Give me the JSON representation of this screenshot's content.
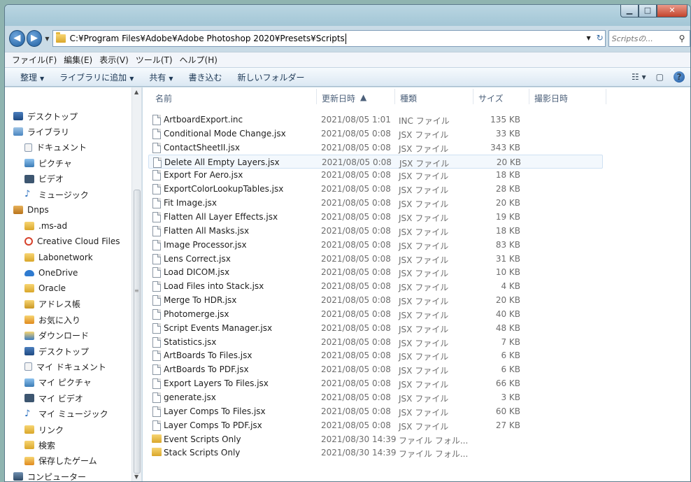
{
  "window": {
    "address_path": "C:¥Program Files¥Adobe¥Adobe Photoshop 2020¥Presets¥Scripts",
    "search_placeholder": "Scriptsの...",
    "caption_min": "▁",
    "caption_max": "□",
    "caption_close": "✕"
  },
  "menu": [
    "ファイル(F)",
    "編集(E)",
    "表示(V)",
    "ツール(T)",
    "ヘルプ(H)"
  ],
  "toolbar": {
    "organize": "整理",
    "add_library": "ライブラリに追加",
    "share": "共有",
    "burn": "書き込む",
    "new_folder": "新しいフォルダー"
  },
  "nav_pane": [
    {
      "label": "デスクトップ",
      "icon": "desktop-icon"
    },
    {
      "label": "ライブラリ",
      "icon": "library-icon"
    },
    {
      "label": "ドキュメント",
      "icon": "documents-icon"
    },
    {
      "label": "ピクチャ",
      "icon": "pictures-icon"
    },
    {
      "label": "ビデオ",
      "icon": "videos-icon"
    },
    {
      "label": "ミュージック",
      "icon": "music-icon"
    },
    {
      "label": "Dnps",
      "icon": "user-folder-icon"
    },
    {
      "label": ".ms-ad",
      "icon": "folder-icon"
    },
    {
      "label": "Creative Cloud Files",
      "icon": "creative-cloud-icon"
    },
    {
      "label": "Labonetwork",
      "icon": "folder-icon"
    },
    {
      "label": "OneDrive",
      "icon": "onedrive-icon"
    },
    {
      "label": "Oracle",
      "icon": "folder-icon"
    },
    {
      "label": "アドレス帳",
      "icon": "contacts-icon"
    },
    {
      "label": "お気に入り",
      "icon": "favorites-icon"
    },
    {
      "label": "ダウンロード",
      "icon": "downloads-icon"
    },
    {
      "label": "デスクトップ",
      "icon": "desktop-folder-icon"
    },
    {
      "label": "マイ ドキュメント",
      "icon": "my-documents-icon"
    },
    {
      "label": "マイ ピクチャ",
      "icon": "my-pictures-icon"
    },
    {
      "label": "マイ ビデオ",
      "icon": "my-videos-icon"
    },
    {
      "label": "マイ ミュージック",
      "icon": "my-music-icon"
    },
    {
      "label": "リンク",
      "icon": "links-icon"
    },
    {
      "label": "検索",
      "icon": "searches-icon"
    },
    {
      "label": "保存したゲーム",
      "icon": "saved-games-icon"
    },
    {
      "label": "コンピューター",
      "icon": "computer-icon"
    }
  ],
  "columns": {
    "name": "名前",
    "date": "更新日時",
    "type": "種類",
    "size": "サイズ",
    "taken": "撮影日時"
  },
  "files": [
    {
      "name": "ArtboardExport.inc",
      "date": "2021/08/05 1:01",
      "type": "INC ファイル",
      "size": "135 KB",
      "kind": "file"
    },
    {
      "name": "Conditional Mode Change.jsx",
      "date": "2021/08/05 0:08",
      "type": "JSX ファイル",
      "size": "33 KB",
      "kind": "file"
    },
    {
      "name": "ContactSheetII.jsx",
      "date": "2021/08/05 0:08",
      "type": "JSX ファイル",
      "size": "343 KB",
      "kind": "file"
    },
    {
      "name": "Delete All Empty Layers.jsx",
      "date": "2021/08/05 0:08",
      "type": "JSX ファイル",
      "size": "20 KB",
      "kind": "file"
    },
    {
      "name": "Export For Aero.jsx",
      "date": "2021/08/05 0:08",
      "type": "JSX ファイル",
      "size": "18 KB",
      "kind": "file"
    },
    {
      "name": "ExportColorLookupTables.jsx",
      "date": "2021/08/05 0:08",
      "type": "JSX ファイル",
      "size": "28 KB",
      "kind": "file"
    },
    {
      "name": "Fit Image.jsx",
      "date": "2021/08/05 0:08",
      "type": "JSX ファイル",
      "size": "20 KB",
      "kind": "file"
    },
    {
      "name": "Flatten All Layer Effects.jsx",
      "date": "2021/08/05 0:08",
      "type": "JSX ファイル",
      "size": "19 KB",
      "kind": "file"
    },
    {
      "name": "Flatten All Masks.jsx",
      "date": "2021/08/05 0:08",
      "type": "JSX ファイル",
      "size": "18 KB",
      "kind": "file"
    },
    {
      "name": "Image Processor.jsx",
      "date": "2021/08/05 0:08",
      "type": "JSX ファイル",
      "size": "83 KB",
      "kind": "file"
    },
    {
      "name": "Lens Correct.jsx",
      "date": "2021/08/05 0:08",
      "type": "JSX ファイル",
      "size": "31 KB",
      "kind": "file"
    },
    {
      "name": "Load DICOM.jsx",
      "date": "2021/08/05 0:08",
      "type": "JSX ファイル",
      "size": "10 KB",
      "kind": "file"
    },
    {
      "name": "Load Files into Stack.jsx",
      "date": "2021/08/05 0:08",
      "type": "JSX ファイル",
      "size": "4 KB",
      "kind": "file"
    },
    {
      "name": "Merge To HDR.jsx",
      "date": "2021/08/05 0:08",
      "type": "JSX ファイル",
      "size": "20 KB",
      "kind": "file"
    },
    {
      "name": "Photomerge.jsx",
      "date": "2021/08/05 0:08",
      "type": "JSX ファイル",
      "size": "40 KB",
      "kind": "file"
    },
    {
      "name": "Script Events Manager.jsx",
      "date": "2021/08/05 0:08",
      "type": "JSX ファイル",
      "size": "48 KB",
      "kind": "file"
    },
    {
      "name": "Statistics.jsx",
      "date": "2021/08/05 0:08",
      "type": "JSX ファイル",
      "size": "7 KB",
      "kind": "file"
    },
    {
      "name": "ArtBoards To Files.jsx",
      "date": "2021/08/05 0:08",
      "type": "JSX ファイル",
      "size": "6 KB",
      "kind": "file"
    },
    {
      "name": "ArtBoards To PDF.jsx",
      "date": "2021/08/05 0:08",
      "type": "JSX ファイル",
      "size": "6 KB",
      "kind": "file"
    },
    {
      "name": "Export Layers To Files.jsx",
      "date": "2021/08/05 0:08",
      "type": "JSX ファイル",
      "size": "66 KB",
      "kind": "file"
    },
    {
      "name": "generate.jsx",
      "date": "2021/08/05 0:08",
      "type": "JSX ファイル",
      "size": "3 KB",
      "kind": "file"
    },
    {
      "name": "Layer Comps To Files.jsx",
      "date": "2021/08/05 0:08",
      "type": "JSX ファイル",
      "size": "60 KB",
      "kind": "file"
    },
    {
      "name": "Layer Comps To PDF.jsx",
      "date": "2021/08/05 0:08",
      "type": "JSX ファイル",
      "size": "27 KB",
      "kind": "file"
    },
    {
      "name": "Event Scripts Only",
      "date": "2021/08/30 14:39",
      "type": "ファイル フォル...",
      "size": "",
      "kind": "folder"
    },
    {
      "name": "Stack Scripts Only",
      "date": "2021/08/30 14:39",
      "type": "ファイル フォル...",
      "size": "",
      "kind": "folder"
    }
  ],
  "highlighted_row": 3
}
